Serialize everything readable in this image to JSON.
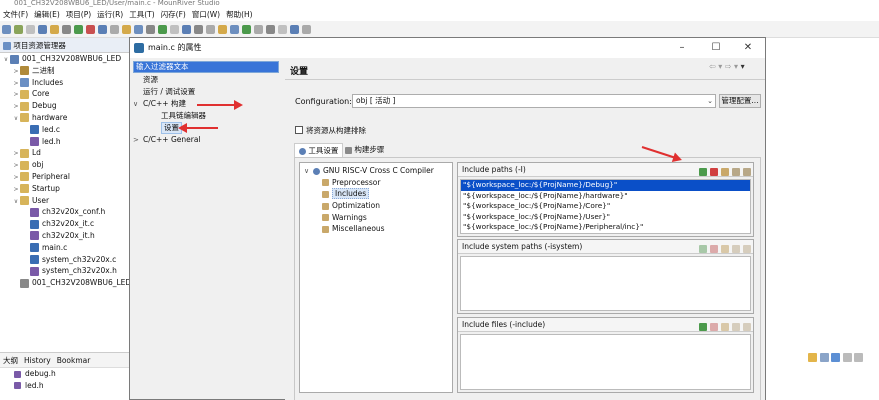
{
  "app": {
    "title": "001_CH32V208WBU6_LED/User/main.c - MounRiver Studio"
  },
  "menu": [
    "文件(F)",
    "编辑(E)",
    "项目(P)",
    "运行(R)",
    "工具(T)",
    "闪存(F)",
    "窗口(W)",
    "帮助(H)"
  ],
  "explorer": {
    "title": "项目资源管理器",
    "items": [
      {
        "label": "001_CH32V208WBU6_LED",
        "indent": 0,
        "twisty": "v",
        "color": "#5b7fb5"
      },
      {
        "label": "二进制",
        "indent": 1,
        "twisty": ">",
        "color": "#b08a3a"
      },
      {
        "label": "Includes",
        "indent": 1,
        "twisty": ">",
        "color": "#6a8fc4"
      },
      {
        "label": "Core",
        "indent": 1,
        "twisty": ">",
        "color": "#d7b45a"
      },
      {
        "label": "Debug",
        "indent": 1,
        "twisty": ">",
        "color": "#d7b45a"
      },
      {
        "label": "hardware",
        "indent": 1,
        "twisty": "v",
        "color": "#d7b45a"
      },
      {
        "label": "led.c",
        "indent": 2,
        "twisty": "",
        "color": "#3a6db3"
      },
      {
        "label": "led.h",
        "indent": 2,
        "twisty": "",
        "color": "#7a5aa8"
      },
      {
        "label": "Ld",
        "indent": 1,
        "twisty": ">",
        "color": "#d7b45a"
      },
      {
        "label": "obj",
        "indent": 1,
        "twisty": ">",
        "color": "#d7b45a"
      },
      {
        "label": "Peripheral",
        "indent": 1,
        "twisty": ">",
        "color": "#d7b45a"
      },
      {
        "label": "Startup",
        "indent": 1,
        "twisty": ">",
        "color": "#d7b45a"
      },
      {
        "label": "User",
        "indent": 1,
        "twisty": "v",
        "color": "#d7b45a"
      },
      {
        "label": "ch32v20x_conf.h",
        "indent": 2,
        "twisty": "",
        "color": "#7a5aa8"
      },
      {
        "label": "ch32v20x_it.c",
        "indent": 2,
        "twisty": "",
        "color": "#3a6db3"
      },
      {
        "label": "ch32v20x_it.h",
        "indent": 2,
        "twisty": "",
        "color": "#7a5aa8"
      },
      {
        "label": "main.c",
        "indent": 2,
        "twisty": "",
        "color": "#3a6db3"
      },
      {
        "label": "system_ch32v20x.c",
        "indent": 2,
        "twisty": "",
        "color": "#3a6db3"
      },
      {
        "label": "system_ch32v20x.h",
        "indent": 2,
        "twisty": "",
        "color": "#7a5aa8"
      },
      {
        "label": "001_CH32V208WBU6_LED",
        "indent": 1,
        "twisty": "",
        "color": "#888888"
      }
    ]
  },
  "outline": {
    "tabs": [
      "大纲",
      "History",
      "Bookmar"
    ],
    "items": [
      "debug.h",
      "led.h"
    ]
  },
  "dialog": {
    "title": "main.c 的属性",
    "filter_text": "输入过滤器文本",
    "nav": [
      {
        "label": "资源",
        "indent": 0,
        "twisty": ""
      },
      {
        "label": "运行 / 调试设置",
        "indent": 0,
        "twisty": ""
      },
      {
        "label": "C/C++ 构建",
        "indent": 0,
        "twisty": "v"
      },
      {
        "label": "工具链编辑器",
        "indent": 1,
        "twisty": ""
      },
      {
        "label": "设置",
        "indent": 1,
        "twisty": "",
        "selected": true
      },
      {
        "label": "C/C++ General",
        "indent": 0,
        "twisty": ">"
      }
    ],
    "page_title": "设置",
    "config_label": "Configuration:",
    "config_value": "obj [ 活动 ]",
    "manage_button": "管理配置...",
    "exclude_label": "将资源从构建排除",
    "tabs": [
      "工具设置",
      "构建步骤"
    ],
    "tool_tree": [
      {
        "label": "GNU RISC-V Cross C Compiler",
        "indent": 0,
        "twisty": "v"
      },
      {
        "label": "Preprocessor",
        "indent": 1
      },
      {
        "label": "Includes",
        "indent": 1,
        "selected": true
      },
      {
        "label": "Optimization",
        "indent": 1
      },
      {
        "label": "Warnings",
        "indent": 1
      },
      {
        "label": "Miscellaneous",
        "indent": 1
      }
    ],
    "include_paths": {
      "title": "Include paths (-I)",
      "items": [
        "\"${workspace_loc:/${ProjName}/Debug}\"",
        "\"${workspace_loc:/${ProjName}/hardware}\"",
        "\"${workspace_loc:/${ProjName}/Core}\"",
        "\"${workspace_loc:/${ProjName}/User}\"",
        "\"${workspace_loc:/${ProjName}/Peripheral/inc}\""
      ]
    },
    "system_paths": {
      "title": "Include system paths (-isystem)"
    },
    "include_files": {
      "title": "Include files (-include)"
    }
  },
  "colors": {
    "selection": "#0a4fc8",
    "annotation_arrow": "#e03030",
    "filter_bg": "#3874d8"
  }
}
